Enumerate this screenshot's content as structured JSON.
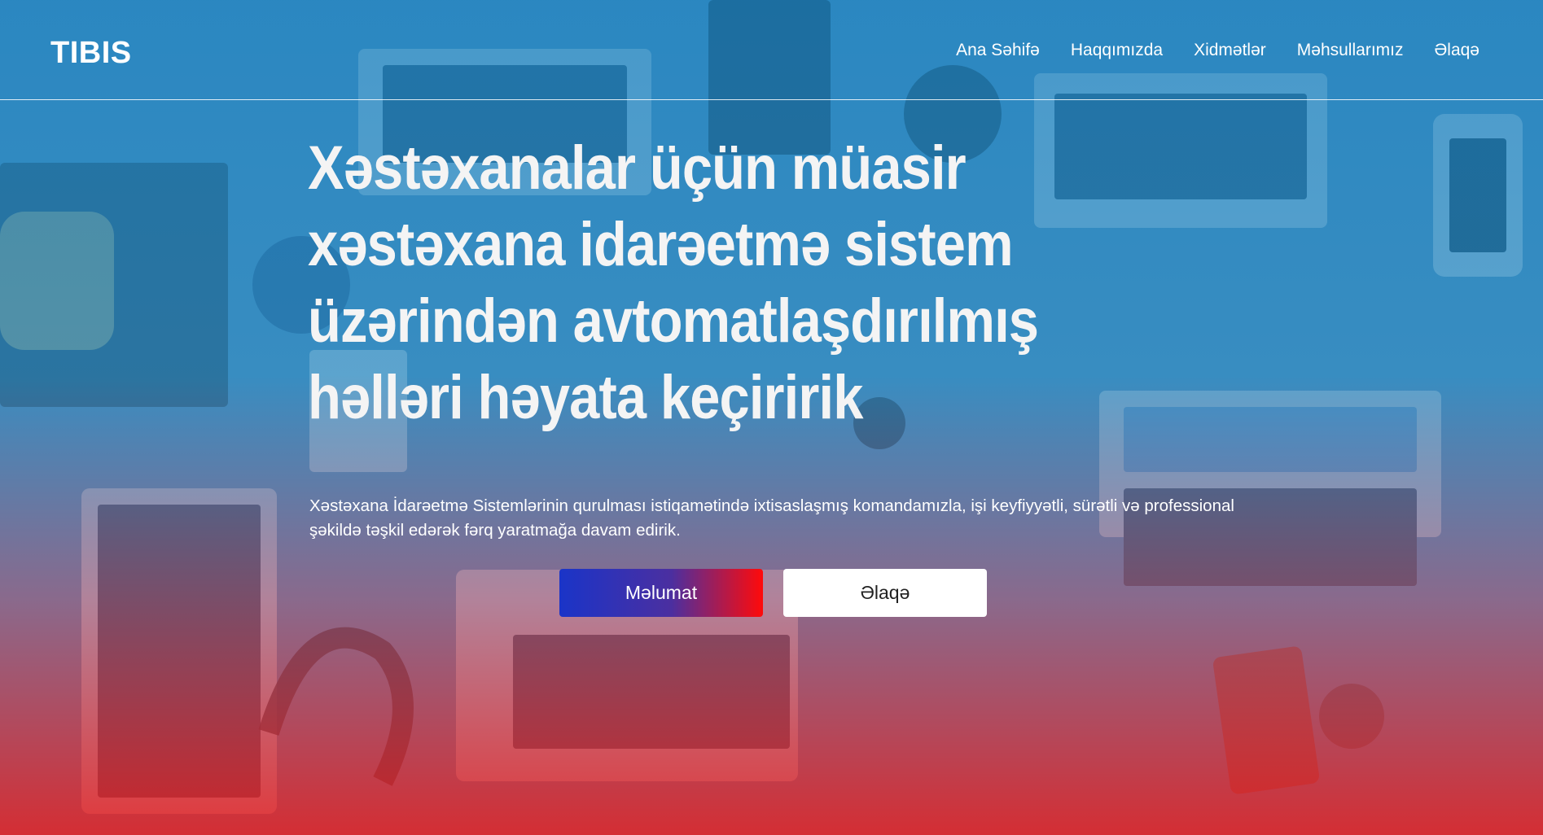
{
  "brand": {
    "logo": "TIBIS"
  },
  "nav": {
    "items": [
      {
        "label": "Ana Səhifə"
      },
      {
        "label": "Haqqımızda"
      },
      {
        "label": "Xidmətlər"
      },
      {
        "label": "Məhsullarımız"
      },
      {
        "label": "Əlaqə"
      }
    ]
  },
  "hero": {
    "headline": "Xəstəxanalar üçün müasir xəstəxana idarəetmə sistem üzərindən avtomatlaşdırılmış həlləri həyata keçiririk",
    "subtext": "Xəstəxana İdarəetmə Sistemlərinin qurulması istiqamətində ixtisaslaşmış komandamızla, işi keyfiyyətli, sürətli və professional şəkildə təşkil edərək fərq yaratmağa davam edirik.",
    "primary_button": "Məlumat",
    "secondary_button": "Əlaqə"
  },
  "colors": {
    "overlay_top": "#1884c4",
    "overlay_bottom": "#e81e1e",
    "button_gradient_start": "#1a34c8",
    "button_gradient_end": "#ff0a0a"
  }
}
